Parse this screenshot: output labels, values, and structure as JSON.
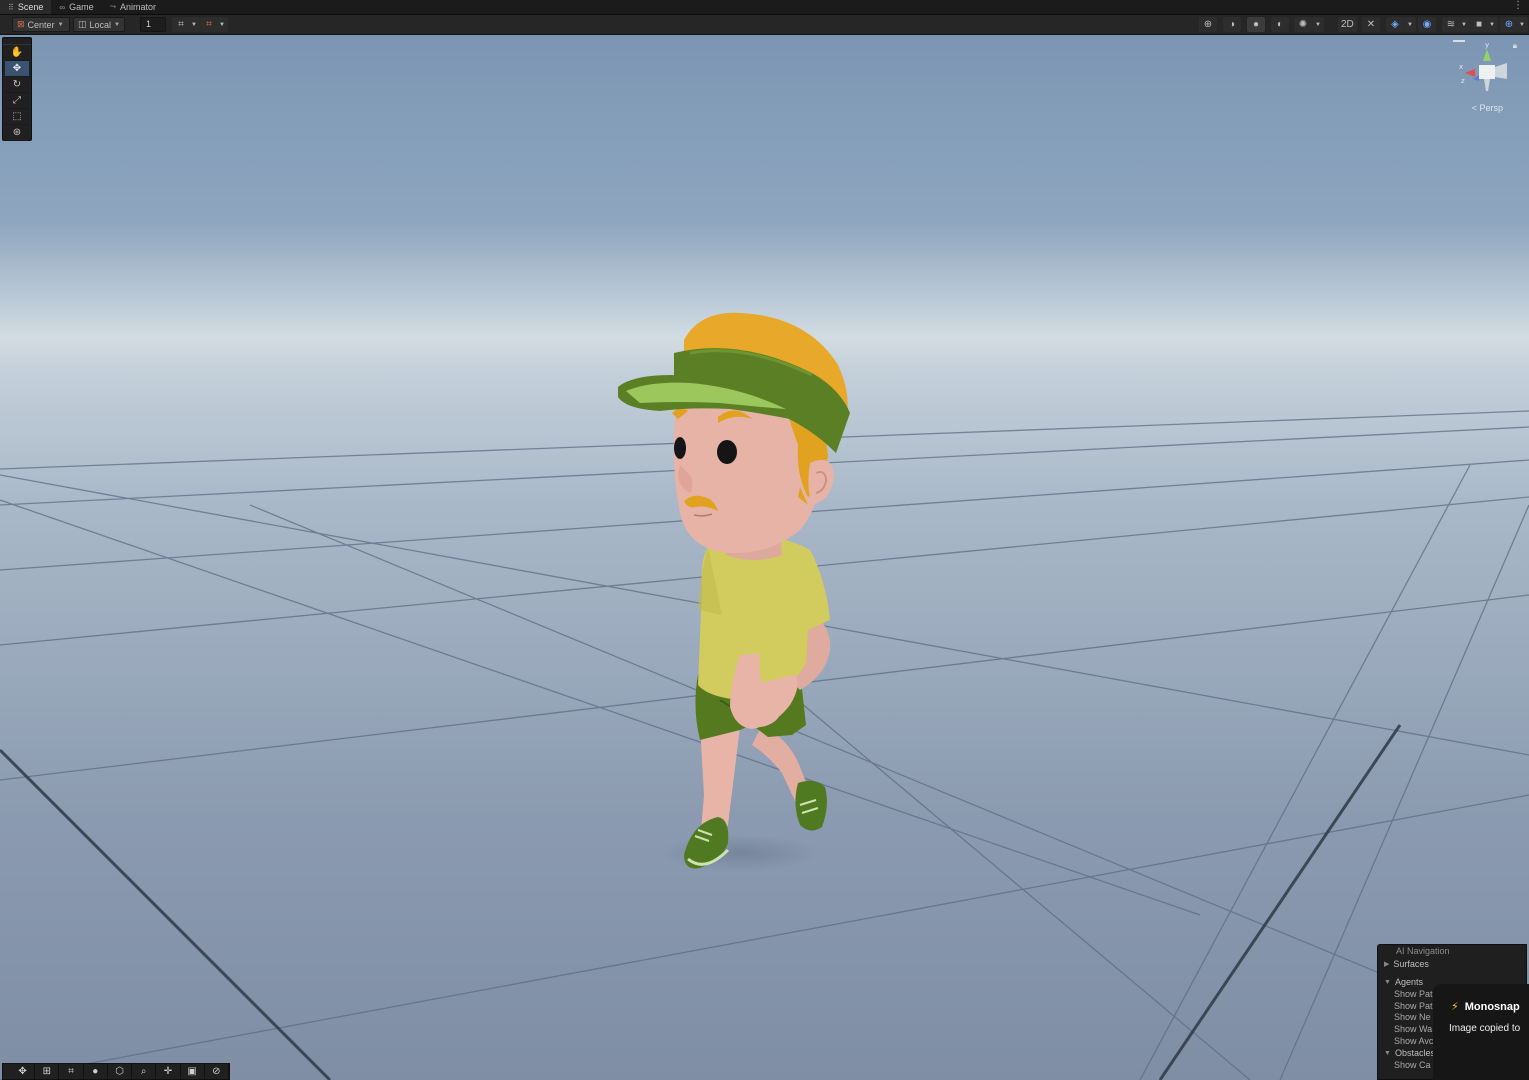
{
  "tabs": [
    {
      "label": "Scene",
      "icon": "grid-icon",
      "active": true
    },
    {
      "label": "Game",
      "icon": "gamepad-icon",
      "active": false
    },
    {
      "label": "Animator",
      "icon": "animator-icon",
      "active": false
    }
  ],
  "toolbar": {
    "pivot_label": "Center",
    "space_label": "Local",
    "grid_value": "1"
  },
  "tools": [
    "hand-tool-icon",
    "move-tool-icon",
    "rotate-tool-icon",
    "scale-tool-icon",
    "rect-tool-icon",
    "transform-tool-icon"
  ],
  "gizmo": {
    "projection_label": "< Persp",
    "axis_y": "y",
    "axis_x": "x",
    "axis_z": "z"
  },
  "ai_navigation": {
    "title": "AI Navigation",
    "surfaces_label": "Surfaces",
    "agents_label": "Agents",
    "agent_items": [
      "Show Pat",
      "Show Pat",
      "Show Ne",
      "Show Wa",
      "Show Avc"
    ],
    "obstacles_label": "Obstacles",
    "obstacle_items": [
      "Show Ca"
    ]
  },
  "toast": {
    "app": "Monosnap",
    "message": "Image copied to"
  },
  "colors": {
    "sky_top": "#7f98b5",
    "horizon": "#d3dde3",
    "ground": "#8b9ab0",
    "accent_blue": "#3a5372"
  }
}
